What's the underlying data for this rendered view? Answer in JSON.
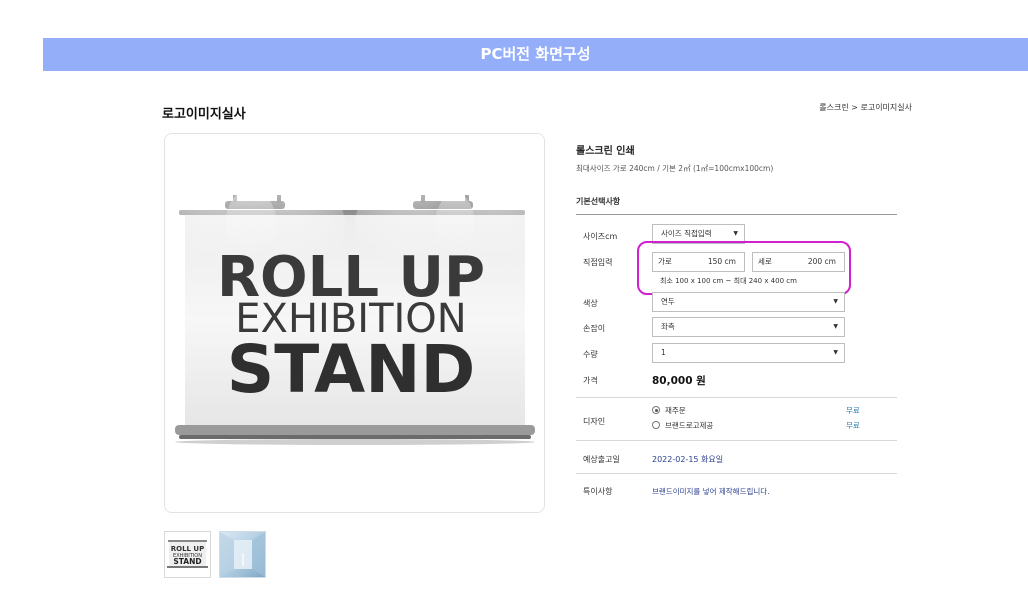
{
  "banner": {
    "title": "PC버전 화면구성"
  },
  "page": {
    "title": "로고이미지실사"
  },
  "breadcrumb": {
    "text": "롤스크린 > 로고이미지실사"
  },
  "product_image": {
    "line1": "ROLL UP",
    "line2": "EXHIBITION",
    "line3": "STAND"
  },
  "thumbnails": [
    {
      "line1": "ROLL UP",
      "line2": "EXHIBITION",
      "line3": "STAND"
    },
    {
      "line1": ""
    }
  ],
  "product": {
    "name": "롤스크린 인쇄",
    "desc": "최대사이즈 가로 240cm / 기본 2㎡ (1㎡=100cmx100cm)"
  },
  "options": {
    "section_title": "기본선택사항",
    "size": {
      "label": "사이즈cm",
      "value": "사이즈 직접입력"
    },
    "direct": {
      "label": "직접입력",
      "width_label": "가로",
      "width_value": "150 cm",
      "height_label": "세로",
      "height_value": "200 cm",
      "range": "최소 100 x 100 cm ~ 최대 240 x 400 cm"
    },
    "color": {
      "label": "색상",
      "value": "연두"
    },
    "handle": {
      "label": "손잡이",
      "value": "좌측"
    },
    "quantity": {
      "label": "수량",
      "value": "1"
    },
    "price": {
      "label": "가격",
      "value": "80,000 원"
    }
  },
  "design": {
    "label": "디자인",
    "choices": [
      {
        "label": "재주문",
        "badge": "무료",
        "checked": true
      },
      {
        "label": "브랜드로고제공",
        "badge": "무료",
        "checked": false
      }
    ]
  },
  "shipping": {
    "label": "예상출고일",
    "value": "2022-02-15 화요일"
  },
  "remarks": {
    "label": "특이사항",
    "value": "브랜드이미지를 넣어 제작해드립니다."
  },
  "colors": {
    "banner": "#94aefa",
    "highlight": "#d21fd0",
    "link": "#2b3f8f",
    "free": "#2f7fb0"
  }
}
